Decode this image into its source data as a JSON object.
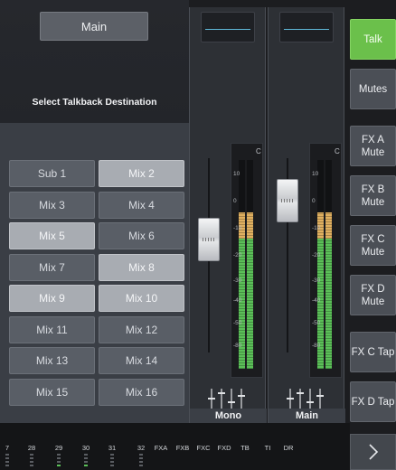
{
  "talkback": {
    "main_label": "Main",
    "title": "Select Talkback Destination",
    "buttons": [
      {
        "label": "Sub 1",
        "active": false
      },
      {
        "label": "Mix 2",
        "active": true
      },
      {
        "label": "Mix 3",
        "active": false
      },
      {
        "label": "Mix 4",
        "active": false
      },
      {
        "label": "Mix 5",
        "active": true
      },
      {
        "label": "Mix 6",
        "active": false
      },
      {
        "label": "Mix 7",
        "active": false
      },
      {
        "label": "Mix 8",
        "active": true
      },
      {
        "label": "Mix 9",
        "active": true
      },
      {
        "label": "Mix 10",
        "active": true
      },
      {
        "label": "Mix 11",
        "active": false
      },
      {
        "label": "Mix 12",
        "active": false
      },
      {
        "label": "Mix 13",
        "active": false
      },
      {
        "label": "Mix 14",
        "active": false
      },
      {
        "label": "Mix 15",
        "active": false
      },
      {
        "label": "Mix 16",
        "active": false
      }
    ]
  },
  "strips": [
    {
      "name": "Mono",
      "fader_level": 0.58,
      "meter_left": 0.72,
      "meter_right": 0.72
    },
    {
      "name": "Main",
      "fader_level": 0.78,
      "meter_left": 0.72,
      "meter_right": 0.72
    }
  ],
  "meter_scale": [
    "C",
    "10",
    "0",
    "-10",
    "-20",
    "-30",
    "-40",
    "-50",
    "-80"
  ],
  "right_buttons": [
    {
      "label": "Talk",
      "active": true
    },
    {
      "label": "Mutes",
      "active": false
    },
    {
      "label": "FX A Mute",
      "active": false
    },
    {
      "label": "FX B Mute",
      "active": false
    },
    {
      "label": "FX C Mute",
      "active": false
    },
    {
      "label": "FX D Mute",
      "active": false
    },
    {
      "label": "FX C Tap",
      "active": false
    },
    {
      "label": "FX D Tap",
      "active": false
    }
  ],
  "bottom_labels": [
    "7",
    "28",
    "29",
    "30",
    "31",
    "32",
    "FXA",
    "FXB",
    "FXC",
    "FXD",
    "TB",
    "TI",
    "DR"
  ],
  "next_icon": "chevron-right-icon",
  "colors": {
    "talk_active": "#6bc04b",
    "button_active": "#a8acb2",
    "scribble_line": "#5fb8d8",
    "meter_green": "#5bbf58",
    "meter_yellow": "#e0b060"
  }
}
